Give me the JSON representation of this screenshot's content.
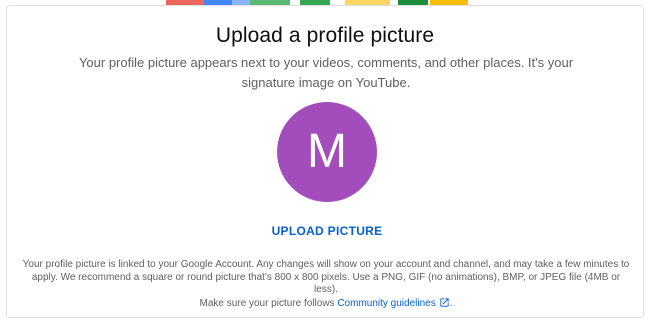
{
  "dialog": {
    "title": "Upload a profile picture",
    "subtitle": "Your profile picture appears next to your videos, comments, and other places. It's your signature image on YouTube.",
    "avatar_initial": "M",
    "upload_label": "UPLOAD PICTURE",
    "fineprint_line1": "Your profile picture is linked to your Google Account. Any changes will show on your account and channel, and may take a few minutes to",
    "fineprint_line2": "apply. We recommend a square or round picture that's 800 x 800 pixels. Use a PNG, GIF (no animations), BMP, or JPEG file (4MB or less).",
    "fineprint_line3": "Make sure your picture follows",
    "guidelines_link": "Community guidelines",
    "fineprint_end": "."
  },
  "icons": {
    "external": "open-in-new-icon"
  },
  "colors": {
    "avatar_bg": "#a34dbd",
    "link": "#065fd4"
  }
}
